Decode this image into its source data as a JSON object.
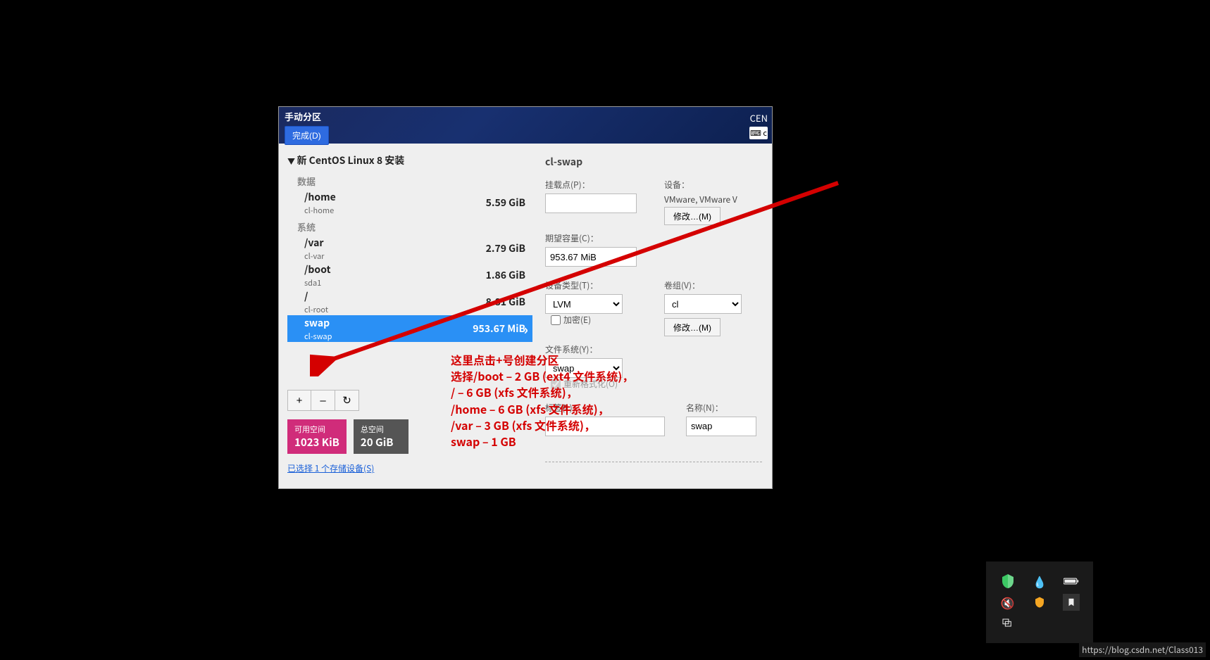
{
  "header": {
    "title": "手动分区",
    "done": "完成(D)",
    "right_text": "CEN",
    "icon_text": "⌨ c"
  },
  "tree": {
    "heading": "新 CentOS Linux 8 安装",
    "cat_data": "数据",
    "cat_system": "系统",
    "rows": [
      {
        "mount": "/home",
        "device": "cl-home",
        "size": "5.59 GiB",
        "cat": "data"
      },
      {
        "mount": "/var",
        "device": "cl-var",
        "size": "2.79 GiB",
        "cat": "sys"
      },
      {
        "mount": "/boot",
        "device": "sda1",
        "size": "1.86 GiB",
        "cat": "sys"
      },
      {
        "mount": "/",
        "device": "cl-root",
        "size": "8.81 GiB",
        "cat": "sys"
      },
      {
        "mount": "swap",
        "device": "cl-swap",
        "size": "953.67 MiB",
        "cat": "sys",
        "selected": true
      }
    ]
  },
  "buttons": {
    "add": "+",
    "remove": "–",
    "reload": "↻"
  },
  "space": {
    "free_label": "可用空间",
    "free_value": "1023 KiB",
    "total_label": "总空间",
    "total_value": "20 GiB"
  },
  "storage_link": "已选择 1 个存储设备(S)",
  "right": {
    "title": "cl-swap",
    "mountpoint_label": "挂载点(P)：",
    "mountpoint_value": "",
    "device_label": "设备：",
    "device_value": "VMware, VMware V",
    "modify_disk": "修改…(M)",
    "capacity_label": "期望容量(C)：",
    "capacity_value": "953.67 MiB",
    "devtype_label": "设备类型(T)：",
    "devtype_value": "LVM",
    "encrypt_label": "加密(E)",
    "vg_label": "卷组(V)：",
    "vg_value": "cl",
    "modify_vg": "修改…(M)",
    "fs_label": "文件系统(Y)：",
    "fs_value": "swap",
    "reformat_label": "重新格式化(O)",
    "label_label": "标签(L)：",
    "label_value": "",
    "name_label": "名称(N)：",
    "name_value": "swap"
  },
  "annotation": {
    "l1": "这里点击+号创建分区",
    "l2": "选择/boot – 2 GB (ext4 文件系统)，",
    "l3": "/ – 6 GB (xfs 文件系统)，",
    "l4": "/home – 6 GB (xfs 文件系统)，",
    "l5": "/var – 3 GB (xfs 文件系统)，",
    "l6": "swap – 1 GB"
  },
  "url": "https://blog.csdn.net/Class013"
}
